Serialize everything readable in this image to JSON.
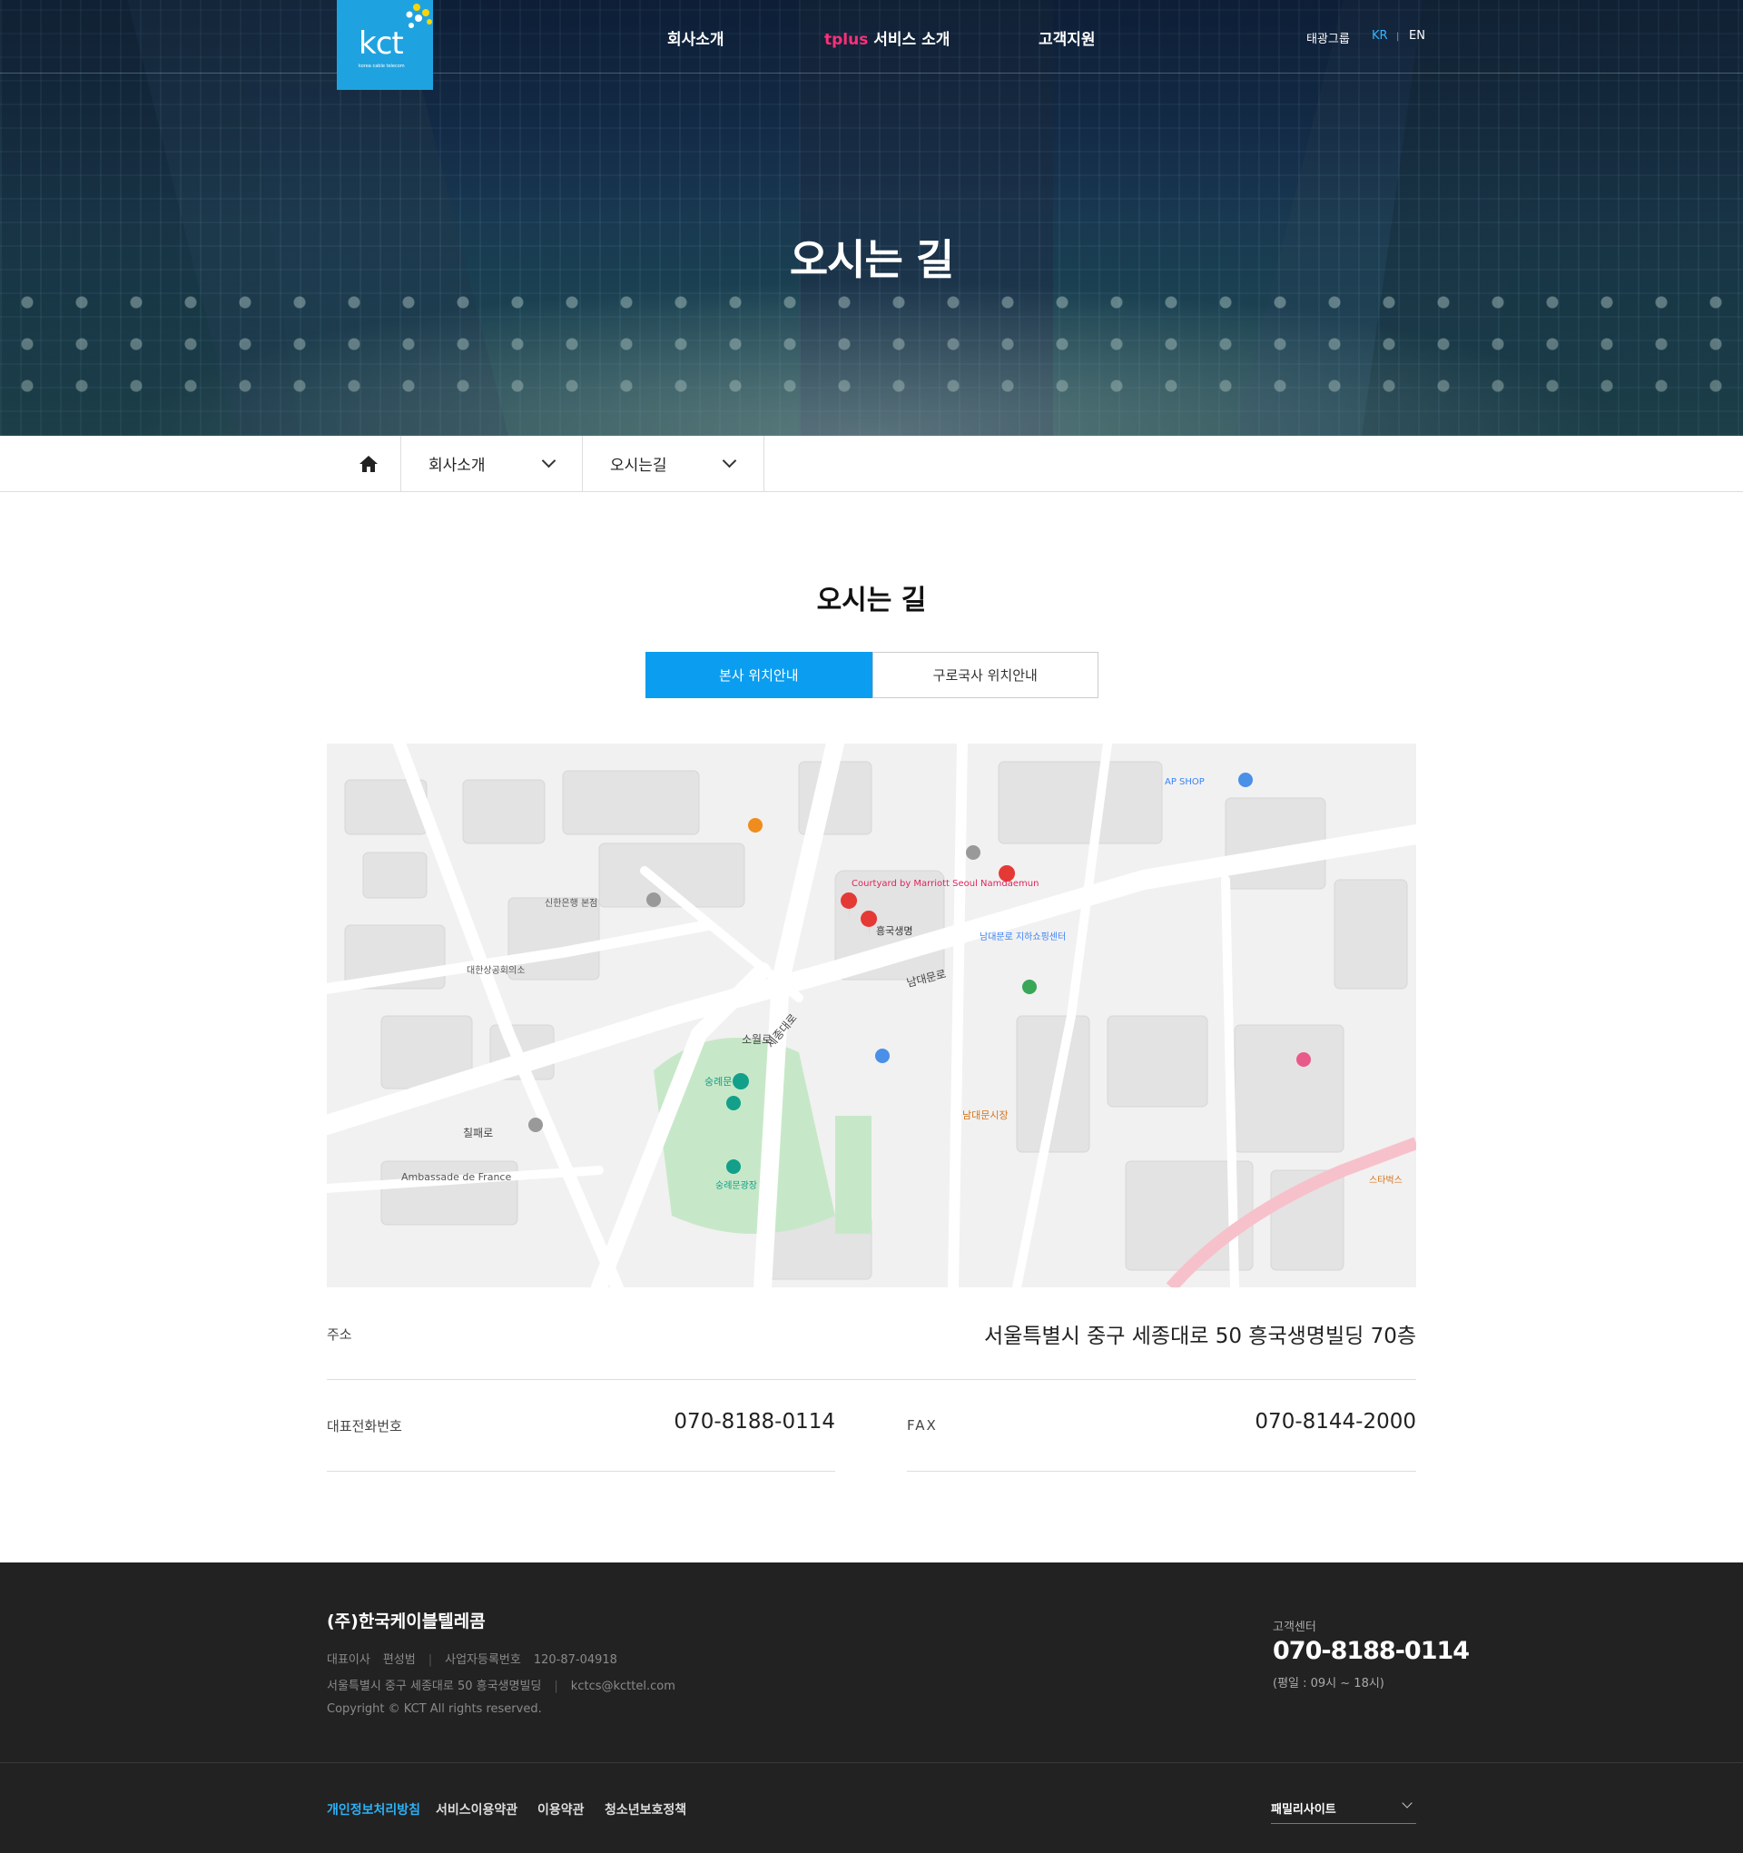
{
  "header": {
    "logo_text": "kct",
    "logo_sub": "korea cable telecom",
    "nav": [
      {
        "label": "회사소개"
      },
      {
        "label_highlight": "tplus",
        "label": "서비스 소개"
      },
      {
        "label": "고객지원"
      }
    ],
    "util": {
      "group": "태광그룹",
      "kr": "KR",
      "sep": "|",
      "en": "EN"
    }
  },
  "hero": {
    "title": "오시는 길"
  },
  "location": {
    "home_icon": "home-icon",
    "depth1": "회사소개",
    "depth2": "오시는길"
  },
  "content": {
    "title": "오시는 길",
    "tabs": [
      {
        "label": "본사 위치안내",
        "active": true
      },
      {
        "label": "구로국사 위치안내",
        "active": false
      }
    ],
    "map_labels": {
      "building": "흥국생명",
      "road1": "세종대로",
      "road2": "남대문로",
      "road3": "칠패로",
      "road4": "소월로",
      "place1": "숭례문",
      "place2": "숭례문광장",
      "place3": "남대문시장",
      "place4": "신한은행 본점",
      "place5": "대한상공회의소",
      "place6": "Ambassade de France",
      "place7": "Courtyard by Marriott Seoul Namdaemun",
      "place8": "AP SHOP",
      "place9": "스타벅스",
      "place10": "남대문로 지하쇼핑센터"
    },
    "address_label": "주소",
    "address_value": "서울특별시 중구 세종대로 50 흥국생명빌딩 70층",
    "phone_label": "대표전화번호",
    "phone_value": "070-8188-0114",
    "fax_label": "FAX",
    "fax_value": "070-8144-2000"
  },
  "footer": {
    "company": "(주)한국케이블텔레콤",
    "ceo_label": "대표이사",
    "ceo": "편성범",
    "bizno_label": "사업자등록번호",
    "bizno": "120-87-04918",
    "address": "서울특별시 중구 세종대로 50 흥국생명빌딩",
    "email": "kctcs@kcttel.com",
    "copyright": "Copyright © KCT All rights reserved.",
    "cs_label": "고객센터",
    "cs_phone": "070-8188-0114",
    "cs_hours": "(평일 : 09시 ~ 18시)",
    "links": [
      "개인정보처리방침",
      "서비스이용약관",
      "이용약관",
      "청소년보호정책"
    ],
    "family_site": "패밀리사이트"
  },
  "colors": {
    "accent": "#0b9ef0",
    "logo": "#1fa3e0",
    "highlight": "#ff2f7a",
    "footer_bg": "#222222"
  }
}
